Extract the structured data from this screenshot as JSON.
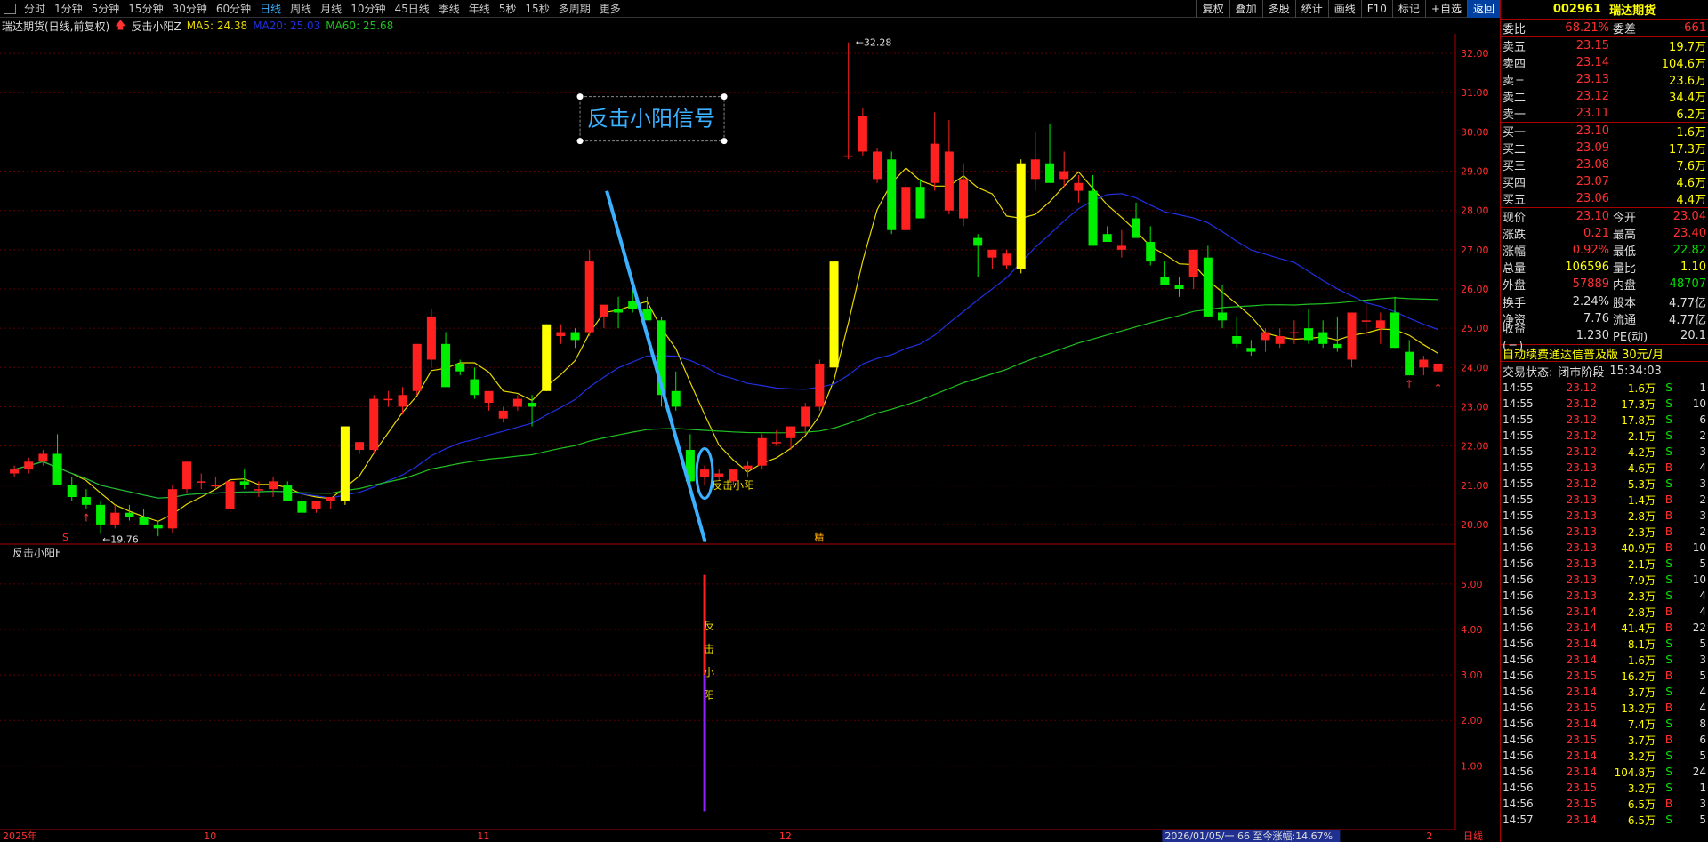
{
  "topbar": {
    "tabs": [
      "分时",
      "1分钟",
      "5分钟",
      "15分钟",
      "30分钟",
      "60分钟",
      "日线",
      "周线",
      "月线",
      "10分钟",
      "45日线",
      "季线",
      "年线",
      "5秒",
      "15秒",
      "多周期",
      "更多"
    ],
    "active": "日线",
    "tools": [
      "复权",
      "叠加",
      "多股",
      "统计",
      "画线",
      "F10",
      "标记",
      "+自选",
      "返回"
    ]
  },
  "chartinfo": {
    "name": "瑞达期货(日线,前复权)",
    "indicator": "反击小阳Z",
    "ma5": "MA5: 24.38",
    "ma20": "MA20: 25.03",
    "ma60": "MA60: 25.68"
  },
  "subinfo": {
    "name": "反击小阳F"
  },
  "annotation": {
    "box": "反击小阳信号",
    "signal": "反击小阳",
    "sub_chars": [
      "反",
      "击",
      "小",
      "阳"
    ],
    "high": "32.28",
    "low": "19.76",
    "s_mark": "S",
    "jing": "精"
  },
  "x_labels": [
    "2025年",
    "10",
    "11",
    "12",
    "2026/01/05/一  66  至今涨幅:14.67%",
    "2",
    "日线"
  ],
  "y_labels": [
    "32.00",
    "31.00",
    "30.00",
    "29.00",
    "28.00",
    "27.00",
    "26.00",
    "25.00",
    "24.00",
    "23.00",
    "22.00",
    "21.00",
    "20.00"
  ],
  "sub_y_labels": [
    "5.00",
    "4.00",
    "3.00",
    "2.00",
    "1.00"
  ],
  "colors": {
    "up": "#ff2020",
    "down": "#00ee00",
    "ma5": "#e8d800",
    "ma20": "#2030e0",
    "ma60": "#20c020",
    "accent": "#3ab0ff"
  },
  "quote": {
    "code": "002961",
    "name": "瑞达期货",
    "weibi_label": "委比",
    "weibi": "-68.21%",
    "weicha_label": "委差",
    "weicha": "-661",
    "sells": [
      {
        "l": "卖五",
        "p": "23.15",
        "v": "19.7万"
      },
      {
        "l": "卖四",
        "p": "23.14",
        "v": "104.6万"
      },
      {
        "l": "卖三",
        "p": "23.13",
        "v": "23.6万"
      },
      {
        "l": "卖二",
        "p": "23.12",
        "v": "34.4万"
      },
      {
        "l": "卖一",
        "p": "23.11",
        "v": "6.2万"
      }
    ],
    "buys": [
      {
        "l": "买一",
        "p": "23.10",
        "v": "1.6万"
      },
      {
        "l": "买二",
        "p": "23.09",
        "v": "17.3万"
      },
      {
        "l": "买三",
        "p": "23.08",
        "v": "7.6万"
      },
      {
        "l": "买四",
        "p": "23.07",
        "v": "4.6万"
      },
      {
        "l": "买五",
        "p": "23.06",
        "v": "4.4万"
      }
    ],
    "stats": [
      {
        "l1": "现价",
        "v1": "23.10",
        "c1": "red",
        "l2": "今开",
        "v2": "23.04",
        "c2": "red"
      },
      {
        "l1": "涨跌",
        "v1": "0.21",
        "c1": "red",
        "l2": "最高",
        "v2": "23.40",
        "c2": "red"
      },
      {
        "l1": "涨幅",
        "v1": "0.92%",
        "c1": "red",
        "l2": "最低",
        "v2": "22.82",
        "c2": "green"
      },
      {
        "l1": "总量",
        "v1": "106596",
        "c1": "yel",
        "l2": "量比",
        "v2": "1.10",
        "c2": "yel"
      },
      {
        "l1": "外盘",
        "v1": "57889",
        "c1": "red",
        "l2": "内盘",
        "v2": "48707",
        "c2": "green"
      }
    ],
    "stats2": [
      {
        "l1": "换手",
        "v1": "2.24%",
        "l2": "股本",
        "v2": "4.77亿"
      },
      {
        "l1": "净资",
        "v1": "7.76",
        "l2": "流通",
        "v2": "4.77亿"
      },
      {
        "l1": "收益(三)",
        "v1": "1.230",
        "l2": "PE(动)",
        "v2": "20.1"
      }
    ],
    "ad": "自动续费通达信普及版  30元/月",
    "status_label": "交易状态:",
    "status": "闭市阶段",
    "time": "15:34:03"
  },
  "ticks": [
    [
      "14:55",
      "23.12",
      "1.6万",
      "S",
      "1"
    ],
    [
      "14:55",
      "23.12",
      "17.3万",
      "S",
      "10"
    ],
    [
      "14:55",
      "23.12",
      "17.8万",
      "S",
      "6"
    ],
    [
      "14:55",
      "23.12",
      "2.1万",
      "S",
      "2"
    ],
    [
      "14:55",
      "23.12",
      "4.2万",
      "S",
      "3"
    ],
    [
      "14:55",
      "23.13",
      "4.6万",
      "B",
      "4"
    ],
    [
      "14:55",
      "23.12",
      "5.3万",
      "S",
      "3"
    ],
    [
      "14:55",
      "23.13",
      "1.4万",
      "B",
      "2"
    ],
    [
      "14:55",
      "23.13",
      "2.8万",
      "B",
      "3"
    ],
    [
      "14:56",
      "23.13",
      "2.3万",
      "B",
      "2"
    ],
    [
      "14:56",
      "23.13",
      "40.9万",
      "B",
      "10"
    ],
    [
      "14:56",
      "23.13",
      "2.1万",
      "S",
      "5"
    ],
    [
      "14:56",
      "23.13",
      "7.9万",
      "S",
      "10"
    ],
    [
      "14:56",
      "23.13",
      "2.3万",
      "S",
      "4"
    ],
    [
      "14:56",
      "23.14",
      "2.8万",
      "B",
      "4"
    ],
    [
      "14:56",
      "23.14",
      "41.4万",
      "B",
      "22"
    ],
    [
      "14:56",
      "23.14",
      "8.1万",
      "S",
      "5"
    ],
    [
      "14:56",
      "23.14",
      "1.6万",
      "S",
      "3"
    ],
    [
      "14:56",
      "23.15",
      "16.2万",
      "B",
      "5"
    ],
    [
      "14:56",
      "23.14",
      "3.7万",
      "S",
      "4"
    ],
    [
      "14:56",
      "23.15",
      "13.2万",
      "B",
      "4"
    ],
    [
      "14:56",
      "23.14",
      "7.4万",
      "S",
      "8"
    ],
    [
      "14:56",
      "23.15",
      "3.7万",
      "B",
      "6"
    ],
    [
      "14:56",
      "23.14",
      "3.2万",
      "S",
      "5"
    ],
    [
      "14:56",
      "23.14",
      "104.8万",
      "S",
      "24"
    ],
    [
      "14:56",
      "23.15",
      "3.2万",
      "S",
      "1"
    ],
    [
      "14:56",
      "23.15",
      "6.5万",
      "B",
      "3"
    ],
    [
      "14:57",
      "23.14",
      "6.5万",
      "S",
      "5"
    ]
  ],
  "chart_data": {
    "type": "candlestick",
    "ylim": [
      19.5,
      32.5
    ],
    "candles": [
      [
        21.3,
        21.5,
        21.2,
        21.4
      ],
      [
        21.4,
        21.7,
        21.3,
        21.6
      ],
      [
        21.6,
        21.9,
        21.5,
        21.8
      ],
      [
        21.8,
        22.3,
        21.6,
        21.0
      ],
      [
        21.0,
        21.2,
        20.6,
        20.7
      ],
      [
        20.7,
        20.9,
        20.4,
        20.5
      ],
      [
        20.5,
        20.6,
        19.76,
        20.0
      ],
      [
        20.0,
        20.5,
        19.9,
        20.3
      ],
      [
        20.3,
        20.5,
        20.1,
        20.2
      ],
      [
        20.2,
        20.4,
        20.0,
        20.0
      ],
      [
        20.0,
        20.1,
        19.7,
        19.9
      ],
      [
        19.9,
        21.0,
        19.8,
        20.9
      ],
      [
        20.9,
        21.6,
        20.8,
        21.6
      ],
      [
        21.1,
        21.3,
        20.9,
        21.1
      ],
      [
        21.0,
        21.2,
        20.9,
        21.0
      ],
      [
        20.4,
        21.1,
        20.3,
        21.1
      ],
      [
        21.1,
        21.4,
        20.9,
        21.0
      ],
      [
        20.9,
        21.1,
        20.7,
        20.9
      ],
      [
        20.9,
        21.2,
        20.7,
        21.1
      ],
      [
        21.0,
        21.1,
        20.6,
        20.6
      ],
      [
        20.6,
        20.8,
        20.4,
        20.3
      ],
      [
        20.4,
        20.6,
        20.3,
        20.6
      ],
      [
        20.6,
        20.7,
        20.4,
        20.7
      ],
      [
        20.6,
        22.5,
        20.5,
        22.5
      ],
      [
        21.9,
        22.1,
        21.8,
        22.1
      ],
      [
        21.9,
        23.3,
        21.8,
        23.2
      ],
      [
        23.2,
        23.4,
        23.0,
        23.2
      ],
      [
        23.0,
        23.5,
        22.8,
        23.3
      ],
      [
        23.4,
        24.6,
        23.3,
        24.6
      ],
      [
        24.2,
        25.5,
        24.0,
        25.3
      ],
      [
        24.6,
        24.9,
        23.8,
        23.5
      ],
      [
        24.1,
        24.2,
        23.8,
        23.9
      ],
      [
        23.7,
        24.0,
        23.2,
        23.3
      ],
      [
        23.1,
        23.2,
        22.9,
        23.4
      ],
      [
        22.7,
        23.0,
        22.6,
        22.9
      ],
      [
        23.0,
        23.3,
        22.9,
        23.2
      ],
      [
        23.1,
        23.3,
        22.5,
        23.0
      ],
      [
        23.4,
        25.1,
        23.4,
        25.1
      ],
      [
        24.8,
        25.1,
        24.6,
        24.9
      ],
      [
        24.9,
        25.0,
        24.5,
        24.7
      ],
      [
        24.9,
        27.0,
        24.8,
        26.7
      ],
      [
        25.3,
        25.6,
        25.0,
        25.6
      ],
      [
        25.5,
        25.8,
        25.0,
        25.4
      ],
      [
        25.7,
        26.0,
        25.4,
        25.5
      ],
      [
        25.5,
        25.8,
        25.3,
        25.2
      ],
      [
        25.2,
        25.3,
        23.0,
        23.3
      ],
      [
        23.4,
        23.9,
        22.9,
        23.0
      ],
      [
        21.9,
        22.3,
        20.9,
        21.1
      ],
      [
        21.2,
        21.5,
        21.0,
        21.4
      ],
      [
        21.2,
        21.4,
        21.1,
        21.3
      ],
      [
        21.1,
        21.4,
        21.0,
        21.4
      ],
      [
        21.4,
        21.6,
        21.2,
        21.5
      ],
      [
        21.5,
        22.3,
        21.4,
        22.2
      ],
      [
        22.1,
        22.4,
        22.0,
        22.1
      ],
      [
        22.2,
        22.5,
        21.9,
        22.5
      ],
      [
        22.5,
        23.1,
        22.3,
        23.0
      ],
      [
        23.0,
        24.2,
        22.9,
        24.1
      ],
      [
        24.0,
        26.7,
        23.9,
        26.7
      ],
      [
        29.4,
        32.28,
        29.3,
        29.4
      ],
      [
        29.5,
        30.6,
        29.4,
        30.4
      ],
      [
        28.8,
        29.6,
        28.7,
        29.5
      ],
      [
        29.3,
        29.5,
        27.4,
        27.5
      ],
      [
        27.5,
        28.7,
        27.5,
        28.6
      ],
      [
        28.6,
        28.8,
        27.8,
        27.8
      ],
      [
        28.7,
        30.5,
        28.5,
        29.7
      ],
      [
        28.0,
        30.3,
        27.9,
        29.5
      ],
      [
        27.8,
        29.2,
        27.6,
        28.8
      ],
      [
        27.3,
        27.4,
        26.3,
        27.1
      ],
      [
        26.8,
        27.0,
        26.5,
        27.0
      ],
      [
        26.6,
        27.0,
        26.5,
        26.9
      ],
      [
        26.5,
        29.3,
        26.4,
        29.2
      ],
      [
        28.8,
        30.0,
        28.5,
        29.3
      ],
      [
        29.2,
        30.2,
        28.8,
        28.7
      ],
      [
        28.8,
        29.5,
        28.6,
        29.0
      ],
      [
        28.5,
        28.9,
        28.2,
        28.7
      ],
      [
        28.5,
        28.9,
        28.2,
        27.1
      ],
      [
        27.4,
        27.6,
        27.2,
        27.2
      ],
      [
        27.0,
        27.5,
        26.8,
        27.1
      ],
      [
        27.8,
        28.2,
        27.4,
        27.3
      ],
      [
        27.2,
        27.6,
        26.6,
        26.7
      ],
      [
        26.3,
        26.7,
        26.1,
        26.1
      ],
      [
        26.1,
        26.3,
        25.8,
        26.0
      ],
      [
        26.3,
        27.0,
        26.0,
        27.0
      ],
      [
        26.8,
        27.1,
        25.3,
        25.3
      ],
      [
        25.4,
        26.1,
        25.0,
        25.2
      ],
      [
        24.8,
        25.3,
        24.5,
        24.6
      ],
      [
        24.5,
        24.7,
        24.3,
        24.4
      ],
      [
        24.7,
        25.0,
        24.4,
        24.9
      ],
      [
        24.6,
        25.0,
        24.5,
        24.8
      ],
      [
        24.9,
        25.2,
        24.6,
        24.9
      ],
      [
        25.0,
        25.5,
        24.6,
        24.7
      ],
      [
        24.9,
        25.2,
        24.5,
        24.6
      ],
      [
        24.6,
        25.3,
        24.4,
        24.5
      ],
      [
        24.2,
        25.4,
        24.0,
        25.4
      ],
      [
        25.2,
        25.6,
        24.8,
        25.2
      ],
      [
        25.0,
        25.4,
        24.6,
        25.2
      ],
      [
        25.4,
        25.8,
        24.5,
        24.5
      ],
      [
        24.4,
        24.7,
        23.8,
        23.8
      ],
      [
        24.0,
        24.3,
        23.8,
        24.2
      ],
      [
        23.9,
        24.2,
        23.7,
        24.1
      ]
    ],
    "signals": {
      "index": 48,
      "arrow_index": 99
    }
  }
}
